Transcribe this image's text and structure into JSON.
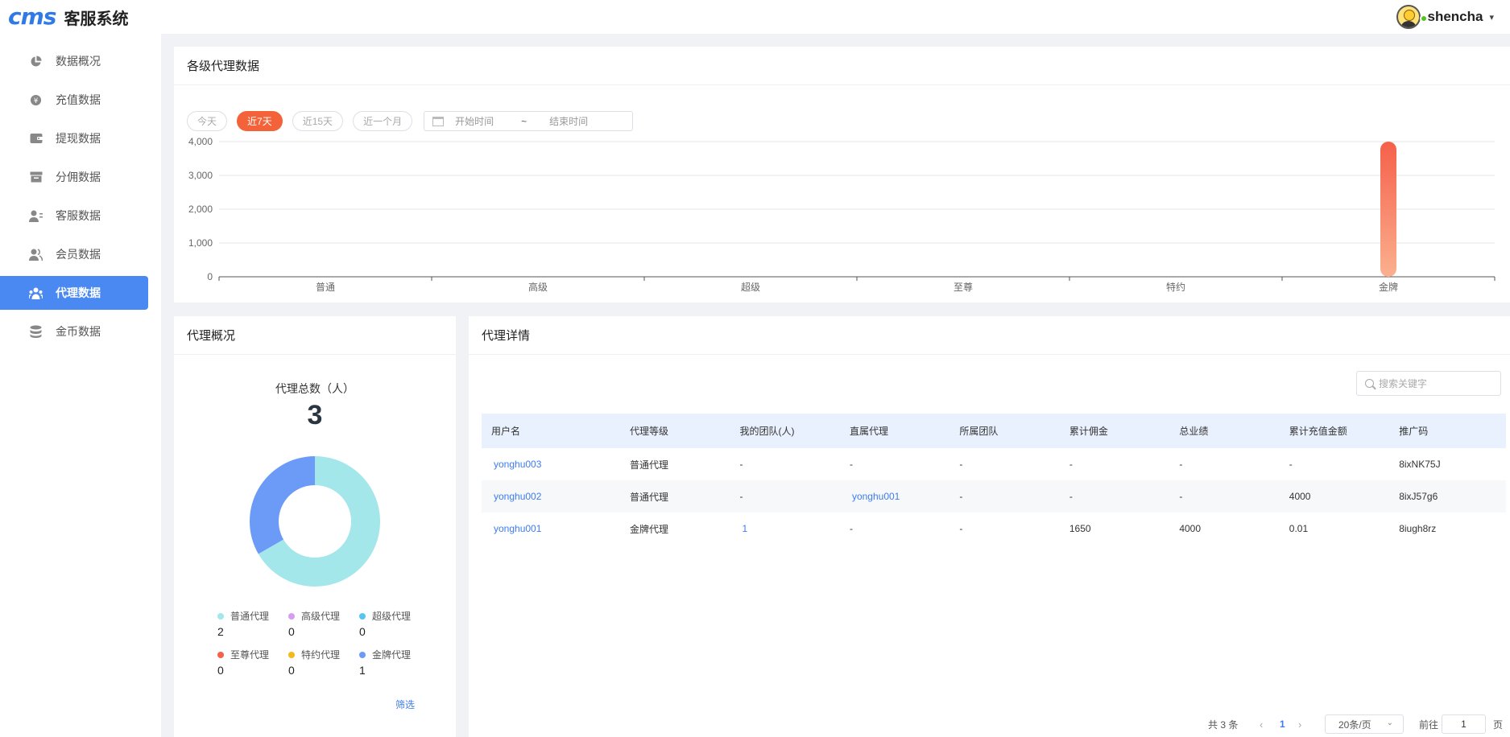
{
  "app": {
    "logo_text": "cms",
    "title": "客服系统"
  },
  "user": {
    "name": "shencha",
    "caret": "▾"
  },
  "sidebar": {
    "items": [
      {
        "label": "数据概况",
        "icon": "pie-chart-icon",
        "active": false
      },
      {
        "label": "充值数据",
        "icon": "yen-coin-icon",
        "active": false
      },
      {
        "label": "提现数据",
        "icon": "wallet-icon",
        "active": false
      },
      {
        "label": "分佣数据",
        "icon": "archive-box-icon",
        "active": false
      },
      {
        "label": "客服数据",
        "icon": "user-list-icon",
        "active": false
      },
      {
        "label": "会员数据",
        "icon": "users-icon",
        "active": false
      },
      {
        "label": "代理数据",
        "icon": "team-icon",
        "active": true
      },
      {
        "label": "金币数据",
        "icon": "coin-stack-icon",
        "active": false
      }
    ]
  },
  "agent_levels_card": {
    "title": "各级代理数据",
    "filters": [
      "今天",
      "近7天",
      "近15天",
      "近一个月"
    ],
    "active_filter": "近7天",
    "date_start_placeholder": "开始时间",
    "date_separator": "~",
    "date_end_placeholder": "结束时间"
  },
  "chart_data": {
    "type": "bar",
    "title": "",
    "xlabel": "",
    "ylabel": "",
    "categories": [
      "普通",
      "高级",
      "超级",
      "至尊",
      "特约",
      "金牌"
    ],
    "values": [
      0,
      0,
      0,
      0,
      0,
      4000
    ],
    "yticks": [
      "0",
      "1,000",
      "2,000",
      "3,000",
      "4,000"
    ],
    "ylim": [
      0,
      4000
    ],
    "bar_color_top": "#f5604a",
    "bar_color_bottom": "#fbb08f",
    "grid": true
  },
  "overview_card": {
    "title": "代理概况",
    "total_label": "代理总数（人）",
    "total_value": "3",
    "donut": {
      "segments": [
        {
          "name": "普通代理",
          "value": 2,
          "color": "#a3e7eb"
        },
        {
          "name": "金牌代理",
          "value": 1,
          "color": "#6b9bf7"
        }
      ]
    },
    "legend": [
      {
        "label": "普通代理",
        "value": "2",
        "color": "#a3e7eb"
      },
      {
        "label": "高级代理",
        "value": "0",
        "color": "#d59df2"
      },
      {
        "label": "超级代理",
        "value": "0",
        "color": "#56c5f2"
      },
      {
        "label": "至尊代理",
        "value": "0",
        "color": "#f5604a"
      },
      {
        "label": "特约代理",
        "value": "0",
        "color": "#f5b81c"
      },
      {
        "label": "金牌代理",
        "value": "1",
        "color": "#6b9bf7"
      }
    ],
    "filter_link": "筛选"
  },
  "details_card": {
    "title": "代理详情",
    "search_placeholder": "搜索关键字",
    "columns": [
      "用户名",
      "代理等级",
      "我的团队(人)",
      "直属代理",
      "所属团队",
      "累计佣金",
      "总业绩",
      "累计充值金额",
      "推广码"
    ],
    "rows": [
      [
        "yonghu003",
        "普通代理",
        "-",
        "-",
        "-",
        "-",
        "-",
        "-",
        "8ixNK75J"
      ],
      [
        "yonghu002",
        "普通代理",
        "-",
        "yonghu001",
        "-",
        "-",
        "-",
        "4000",
        "8ixJ57g6"
      ],
      [
        "yonghu001",
        "金牌代理",
        "1",
        "-",
        "-",
        "1650",
        "4000",
        "0.01",
        "8iugh8rz"
      ]
    ],
    "link_cells": [
      [
        0,
        0
      ],
      [
        1,
        0
      ],
      [
        2,
        0
      ],
      [
        1,
        3
      ],
      [
        2,
        2
      ]
    ],
    "pagination": {
      "total_text": "共 3 条",
      "prev": "‹",
      "current_page": "1",
      "next": "›",
      "page_size": "20条/页",
      "goto_label": "前往",
      "goto_value": "1",
      "page_suffix": "页"
    }
  },
  "colors": {
    "primary": "#4a88f2",
    "accent": "#f4623a",
    "link": "#3d7cf0"
  }
}
